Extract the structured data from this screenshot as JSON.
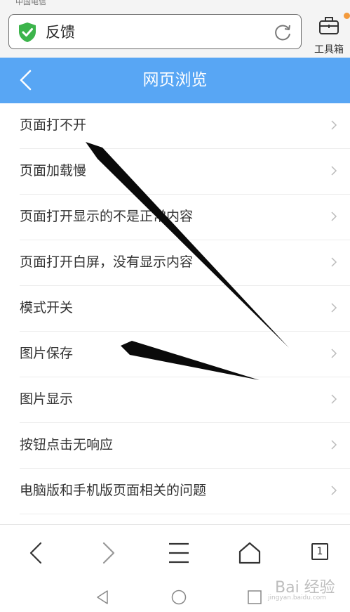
{
  "status_bar": {
    "carrier": "中国电信"
  },
  "address_bar": {
    "page_title": "反馈"
  },
  "toolbox": {
    "label": "工具箱"
  },
  "header": {
    "title": "网页浏览"
  },
  "menu": {
    "items": [
      {
        "label": "页面打不开"
      },
      {
        "label": "页面加载慢"
      },
      {
        "label": "页面打开显示的不是正常内容"
      },
      {
        "label": "页面打开白屏，没有显示内容"
      },
      {
        "label": "模式开关"
      },
      {
        "label": "图片保存"
      },
      {
        "label": "图片显示"
      },
      {
        "label": "按钮点击无响应"
      },
      {
        "label": "电脑版和手机版页面相关的问题"
      }
    ]
  },
  "bottom_nav": {
    "tab_count": "1"
  },
  "watermark": {
    "brand": "Bai 经验",
    "url": "jingyan.baidu.com"
  },
  "colors": {
    "header_bg": "#58a6f4",
    "shield_green": "#3cb44b",
    "notify_dot": "#f39a3c"
  },
  "icons": [
    "shield-check-icon",
    "reload-icon",
    "toolbox-icon",
    "back-chevron-icon",
    "chevron-right-icon",
    "nav-back-icon",
    "nav-forward-icon",
    "menu-icon",
    "home-icon",
    "tabs-icon",
    "system-back-icon",
    "system-home-icon",
    "system-recent-icon"
  ]
}
